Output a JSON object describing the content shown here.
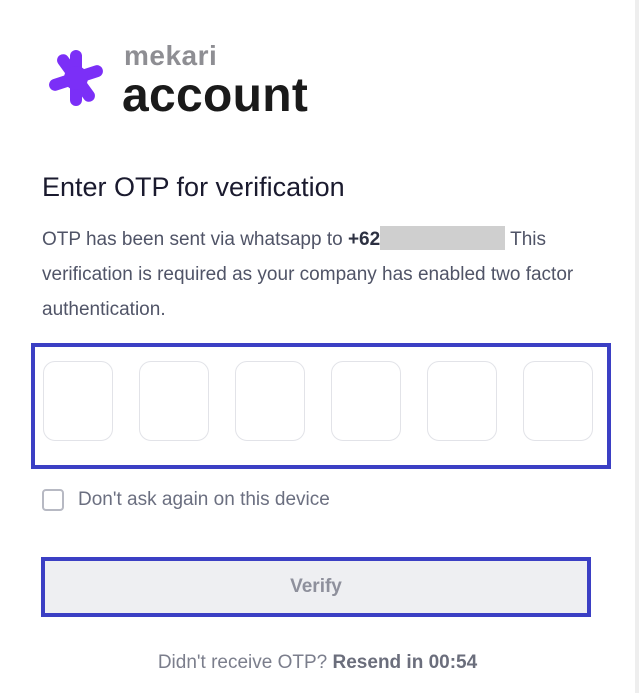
{
  "brand": {
    "sub": "mekari",
    "main": "account",
    "accent_color": "#7b2ff7"
  },
  "heading": "Enter OTP for verification",
  "description": {
    "before_phone": "OTP has been sent via whatsapp to ",
    "phone_prefix": "+62",
    "after_phone": " This verification is required as your company has enabled two factor authentication."
  },
  "otp": {
    "digits": [
      "",
      "",
      "",
      "",
      "",
      ""
    ]
  },
  "remember": {
    "label": "Don't ask again on this device",
    "checked": false
  },
  "verify": {
    "label": "Verify"
  },
  "resend": {
    "prompt": "Didn't receive OTP?",
    "link": "Resend in 00:54"
  },
  "colors": {
    "highlight_border": "#3b3fc4",
    "button_bg": "#eeeff2"
  }
}
